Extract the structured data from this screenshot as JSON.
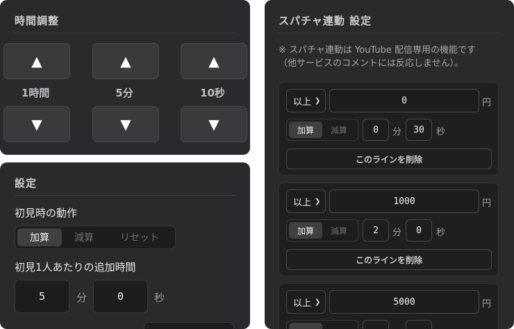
{
  "time_panel": {
    "title": "時間調整",
    "up_icon": "▲",
    "down_icon": "▼",
    "units": [
      "1時間",
      "5分",
      "10秒"
    ]
  },
  "settings_panel": {
    "title": "設定",
    "first_action_label": "初見時の動作",
    "first_action_options": [
      "加算",
      "減算",
      "リセット"
    ],
    "first_action_selected": "加算",
    "extra_time_label": "初見1人あたりの追加時間",
    "extra_minutes": "5",
    "extra_seconds": "0",
    "minutes_unit": "分",
    "seconds_unit": "秒"
  },
  "superchat_panel": {
    "title": "スパチャ連動 設定",
    "note_line1": "※ スパチャ連動は YouTube 配信専用の機能です",
    "note_line2": "（他サービスのコメントには反応しません）。",
    "condition_select": "以上",
    "yen_unit": "円",
    "add_label": "加算",
    "sub_label": "減算",
    "minutes_unit": "分",
    "seconds_unit": "秒",
    "delete_label": "このラインを削除",
    "rules": [
      {
        "amount": "0",
        "mode": "加算",
        "minutes": "0",
        "seconds": "30"
      },
      {
        "amount": "1000",
        "mode": "加算",
        "minutes": "2",
        "seconds": "0"
      },
      {
        "amount": "5000",
        "mode": "加算",
        "minutes": "",
        "seconds": ""
      }
    ]
  }
}
